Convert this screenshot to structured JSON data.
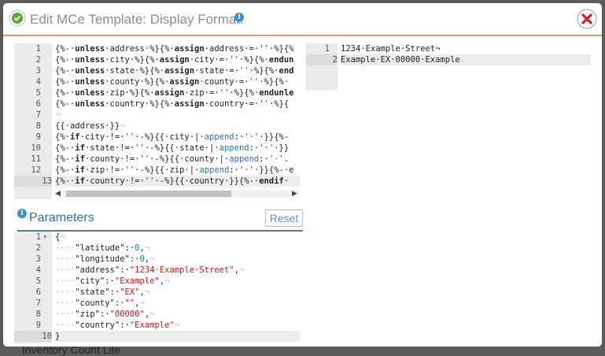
{
  "background": {
    "peek_text": "Inventory Count Lite"
  },
  "dialog": {
    "title": "Edit MCe Template: Display Format:",
    "info_glyph": "i",
    "close_glyph": "✕"
  },
  "template_editor": {
    "line_numbers": [
      "1",
      "2",
      "3",
      "4",
      "5",
      "6",
      "7",
      "8",
      "9",
      "10",
      "11",
      "12",
      "13"
    ],
    "active_line": 13
  },
  "preview_editor": {
    "line_numbers": [
      "1",
      "2"
    ],
    "lines": [
      "1234·Example·Street¬",
      "Example·EX·00000·Example"
    ],
    "active_line": 2
  },
  "parameters": {
    "title": "Parameters",
    "reset_label": "Reset",
    "line_numbers": [
      "1",
      "2",
      "3",
      "4",
      "5",
      "6",
      "7",
      "8",
      "9",
      "10"
    ],
    "fold_glyph": "▾",
    "active_line": 10
  },
  "colors": {
    "accent": "#c9a26e",
    "keyword": "#222222",
    "string": "#c41a16",
    "number": "#1c8a6e",
    "filter": "#2a6fc9"
  },
  "icons": {
    "header": "check-circle-icon",
    "info": "info-icon",
    "close": "close-icon"
  }
}
